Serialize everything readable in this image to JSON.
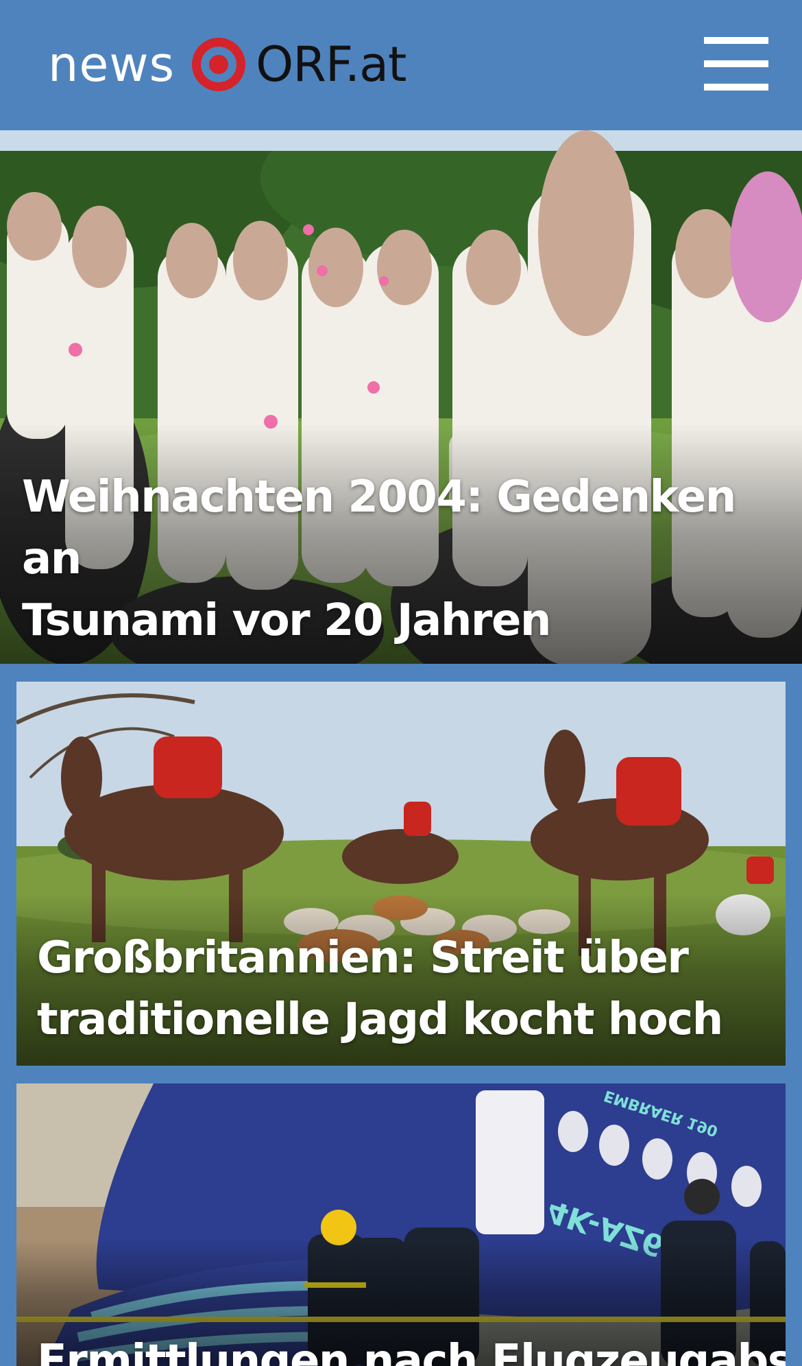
{
  "header": {
    "logo": {
      "news_text": "news",
      "brand_text": "ORF.at"
    },
    "menu_icon": "hamburger-menu-icon"
  },
  "colors": {
    "header_background": "#4f83bd",
    "logo_red": "#d4232a",
    "headline_text": "#ffffff"
  },
  "stories": [
    {
      "headline_line1": "Weihnachten 2004: Gedenken an",
      "headline_line2": "Tsunami vor 20 Jahren"
    },
    {
      "headline_line1": "Großbritannien: Streit über",
      "headline_line2": "traditionelle Jagd kocht hoch"
    },
    {
      "headline_line1": "Ermittlungen nach Flugzeugabsturz"
    }
  ],
  "photo_texts": {
    "aircraft_registration": "4K-AZ65",
    "aircraft_model": "EMBRAER 190"
  }
}
